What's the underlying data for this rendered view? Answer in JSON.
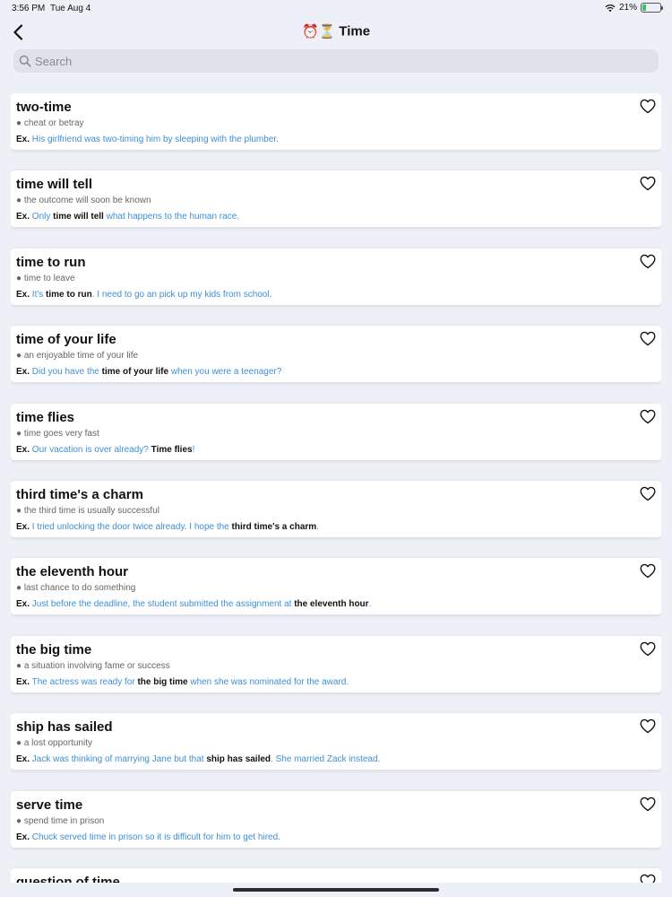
{
  "status": {
    "time": "3:56 PM",
    "date": "Tue Aug 4",
    "battery_percent": "21%",
    "battery_level": 0.21
  },
  "nav": {
    "title_emoji": "⏰⏳",
    "title": "Time"
  },
  "search": {
    "placeholder": "Search"
  },
  "items": [
    {
      "title": "two-time",
      "definition": "● cheat or betray",
      "example_label": "Ex.",
      "example": [
        {
          "t": " His girlfriend was two-timing him by sleeping with the plumber.",
          "b": false
        }
      ]
    },
    {
      "title": "time will tell",
      "definition": "● the outcome will soon be known",
      "example_label": "Ex.",
      "example": [
        {
          "t": " Only ",
          "b": false
        },
        {
          "t": "time will tell",
          "b": true
        },
        {
          "t": " what happens to the human race.",
          "b": false
        }
      ]
    },
    {
      "title": "time to run",
      "definition": "● time to leave",
      "example_label": "Ex.",
      "example": [
        {
          "t": " It's ",
          "b": false
        },
        {
          "t": "time to run",
          "b": true
        },
        {
          "t": ". I need to go an pick up my kids from school.",
          "b": false
        }
      ]
    },
    {
      "title": "time of your life",
      "definition": "● an enjoyable time of your life",
      "example_label": "Ex.",
      "example": [
        {
          "t": " Did you have the ",
          "b": false
        },
        {
          "t": "time of your life",
          "b": true
        },
        {
          "t": " when you were a teenager?",
          "b": false
        }
      ]
    },
    {
      "title": "time flies",
      "definition": "● time goes very fast",
      "example_label": "Ex.",
      "example": [
        {
          "t": " Our vacation is over already? ",
          "b": false
        },
        {
          "t": "Time flies",
          "b": true
        },
        {
          "t": "!",
          "b": false
        }
      ]
    },
    {
      "title": "third time's a charm",
      "definition": "● the third time is usually successful",
      "example_label": "Ex.",
      "example": [
        {
          "t": " I tried unlocking the door twice already. I hope the ",
          "b": false
        },
        {
          "t": "third time's a charm",
          "b": true
        },
        {
          "t": ".",
          "b": false
        }
      ]
    },
    {
      "title": "the eleventh hour",
      "definition": "● last chance to do something",
      "example_label": "Ex.",
      "example": [
        {
          "t": " Just before the deadline, the student submitted the assignment at ",
          "b": false
        },
        {
          "t": "the eleventh hour",
          "b": true
        },
        {
          "t": ".",
          "b": false
        }
      ]
    },
    {
      "title": "the big time",
      "definition": "● a situation involving fame or success",
      "example_label": "Ex.",
      "example": [
        {
          "t": " The actress was ready for ",
          "b": false
        },
        {
          "t": "the big time",
          "b": true
        },
        {
          "t": " when she was nominated for the award.",
          "b": false
        }
      ]
    },
    {
      "title": "ship has sailed",
      "definition": "● a lost opportunity",
      "example_label": "Ex.",
      "example": [
        {
          "t": " Jack was thinking of marrying Jane but that ",
          "b": false
        },
        {
          "t": "ship has sailed",
          "b": true
        },
        {
          "t": ". She married Zack instead.",
          "b": false
        }
      ]
    },
    {
      "title": "serve time",
      "definition": "● spend time in prison",
      "example_label": "Ex.",
      "example": [
        {
          "t": " Chuck served time in prison so it is difficult for him to get hired.",
          "b": false
        }
      ]
    },
    {
      "title": "question of time",
      "definition": "",
      "example_label": "",
      "example": []
    }
  ],
  "colors": {
    "accent": "#3d8fd6",
    "background": "#eef0f7"
  }
}
